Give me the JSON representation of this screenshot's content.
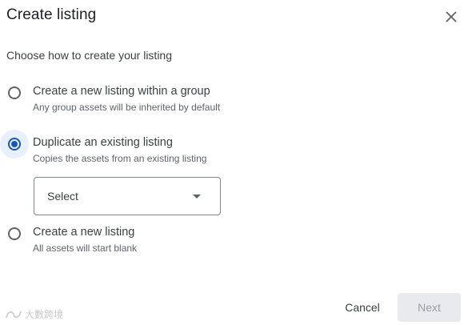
{
  "dialog": {
    "title": "Create listing",
    "close_icon": "close-icon",
    "subtitle": "Choose how to create your listing"
  },
  "options": [
    {
      "label": "Create a new listing within a group",
      "description": "Any group assets will be inherited by default",
      "selected": false
    },
    {
      "label": "Duplicate an existing listing",
      "description": "Copies the assets from an existing listing",
      "selected": true
    },
    {
      "label": "Create a new listing",
      "description": "All assets will start blank",
      "selected": false
    }
  ],
  "select": {
    "value": "Select",
    "arrow_icon": "dropdown-arrow-icon"
  },
  "footer": {
    "cancel_label": "Cancel",
    "next_label": "Next"
  },
  "watermark": {
    "text": "大數跨境"
  },
  "colors": {
    "accent": "#1a57b8",
    "selected_halo": "#e8f0fe",
    "disabled_bg": "#e8eaed",
    "disabled_text": "#9aa0a6"
  }
}
